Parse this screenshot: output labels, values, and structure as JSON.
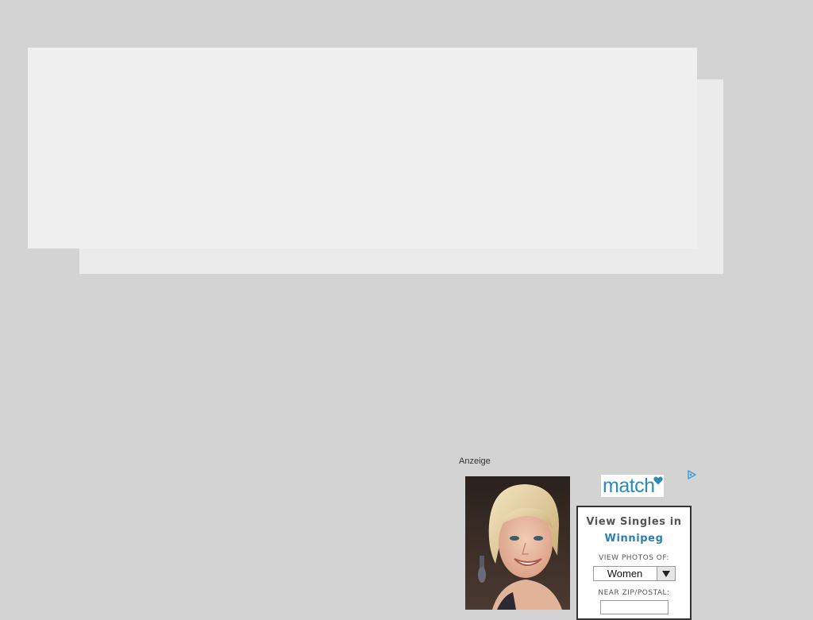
{
  "colors": {
    "page_background": "#d3d3d3",
    "panel_front": "#efefef",
    "panel_back": "#ebebeb",
    "match_blue": "#2a8ab8",
    "city_link": "#2a7fb0"
  },
  "ad": {
    "label": "Anzeige",
    "adchoices_icon": "play-triangle-icon",
    "brand_logo_text": "match",
    "brand_logo_icon": "heart-icon",
    "photo": "portrait-photo",
    "widget": {
      "title": "View Singles in",
      "city": "Winnipeg",
      "view_photos_label": "VIEW PHOTOS OF:",
      "gender_selected": "Women",
      "zip_label": "NEAR ZIP/POSTAL:",
      "zip_value": ""
    }
  }
}
